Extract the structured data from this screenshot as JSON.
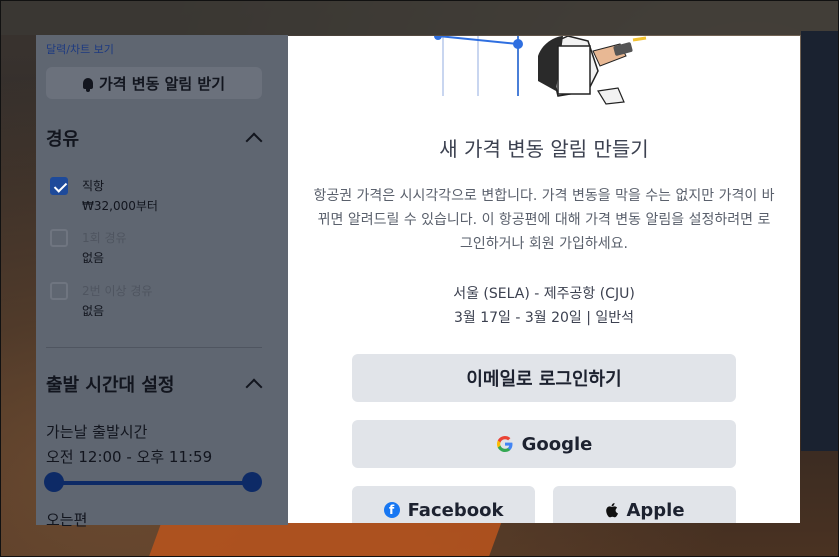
{
  "filters": {
    "calendar_link": "달력/차트 보기",
    "price_alert_button": "가격 변동 알림 받기",
    "stops": {
      "title": "경유",
      "options": [
        {
          "label": "직항",
          "detail": "₩32,000부터",
          "checked": true
        },
        {
          "label": "1회 경유",
          "detail": "없음",
          "checked": false
        },
        {
          "label": "2번 이상 경유",
          "detail": "없음",
          "checked": false
        }
      ]
    },
    "departure_time": {
      "title": "출발 시간대 설정",
      "outbound_label": "가는날 출발시간",
      "outbound_range": "오전 12:00 - 오후 11:59",
      "return_label": "오는편"
    }
  },
  "modal": {
    "title": "새 가격 변동 알림 만들기",
    "description": "항공권 가격은 시시각각으로 변합니다. 가격 변동을 막을 수는 없지만 가격이 바뀌면 알려드릴 수 있습니다. 이 항공편에 대해 가격 변동 알림을 설정하려면 로그인하거나 회원 가입하세요.",
    "route": "서울 (SELA) - 제주공항 (CJU)",
    "dates_class": "3월 17일 - 3월 20일 | 일반석",
    "email_button": "이메일로 로그인하기",
    "google_button": "Google",
    "facebook_button": "Facebook",
    "apple_button": "Apple"
  },
  "colors": {
    "accent": "#1e4a9a",
    "button_bg": "#e1e4e9",
    "overlay_panel": "#5f6671"
  }
}
